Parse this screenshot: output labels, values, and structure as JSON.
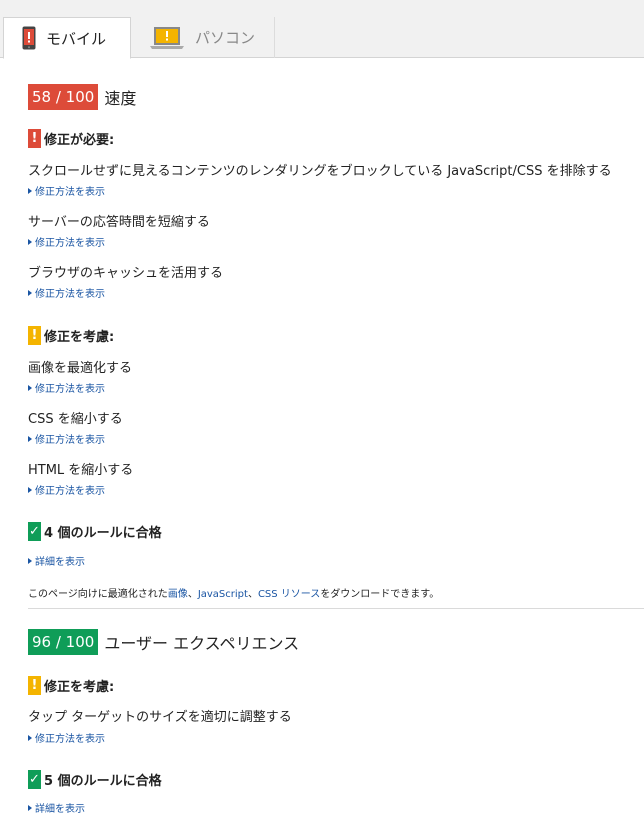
{
  "tabs": [
    {
      "label": "モバイル",
      "icon": "mobile-phone-icon"
    },
    {
      "label": "パソコン",
      "icon": "desktop-laptop-icon"
    }
  ],
  "colors": {
    "red": "#dd4b39",
    "orange": "#f4b400",
    "green": "#0f9d58",
    "link": "#1a55a3"
  },
  "speed": {
    "score": "58 / 100",
    "label": "速度",
    "must_fix": {
      "heading": "修正が必要:",
      "rules": [
        "スクロールせずに見えるコンテンツのレンダリングをブロックしている JavaScript/CSS を排除する",
        "サーバーの応答時間を短縮する",
        "ブラウザのキャッシュを活用する"
      ]
    },
    "consider_fixing": {
      "heading": "修正を考慮:",
      "rules": [
        "画像を最適化する",
        "CSS を縮小する",
        "HTML を縮小する"
      ]
    },
    "passed": {
      "heading": "4 個のルールに合格",
      "link": "詳細を表示"
    },
    "note": {
      "prefix": "このページ向けに最適化された",
      "link1": "画像",
      "sep1": "、",
      "link2": "JavaScript",
      "sep2": "、",
      "link3": "CSS リソース",
      "suffix": "をダウンロードできます。"
    }
  },
  "ux": {
    "score": "96 / 100",
    "label": "ユーザー エクスペリエンス",
    "consider_fixing": {
      "heading": "修正を考慮:",
      "rules": [
        "タップ ターゲットのサイズを適切に調整する"
      ]
    },
    "passed": {
      "heading": "5 個のルールに合格",
      "link": "詳細を表示"
    }
  },
  "show_fix_label": "修正方法を表示"
}
